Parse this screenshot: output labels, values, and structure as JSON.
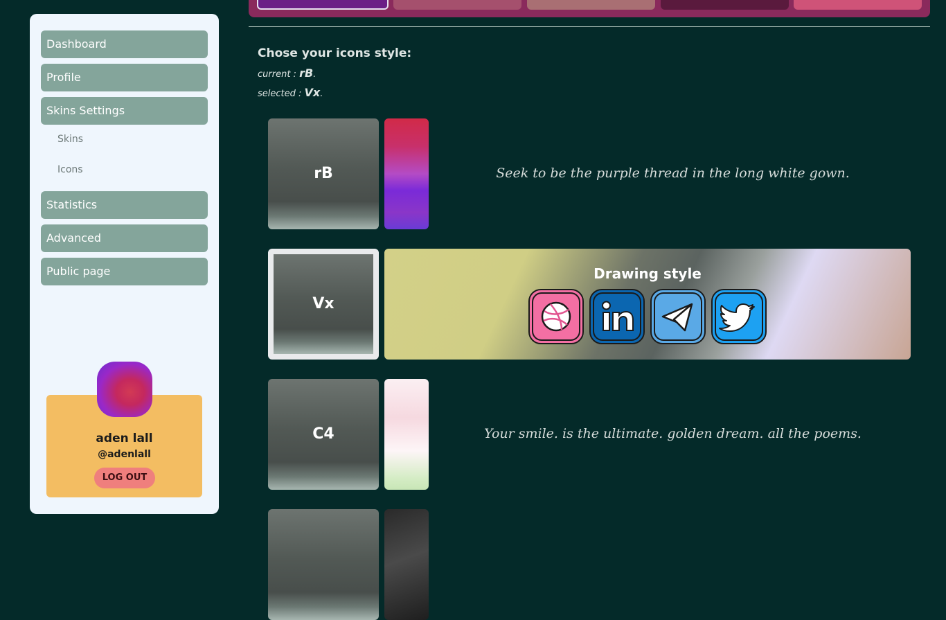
{
  "sidebar": {
    "items": [
      {
        "label": "Dashboard"
      },
      {
        "label": "Profile"
      },
      {
        "label": "Skins Settings"
      },
      {
        "label": "Statistics"
      },
      {
        "label": "Advanced"
      },
      {
        "label": "Public page"
      }
    ],
    "sub_items": [
      {
        "label": "Skins"
      },
      {
        "label": "Icons"
      }
    ],
    "profile": {
      "name": "aden lall",
      "handle": "@adenlall",
      "logout_label": "LOG OUT"
    }
  },
  "top_tabs": [
    {
      "color": "#6b1e86",
      "selected": true
    },
    {
      "color": "#a5506d"
    },
    {
      "color": "#a96f73"
    },
    {
      "color": "#5a1a3d"
    },
    {
      "color": "#cf5378"
    }
  ],
  "icons_section": {
    "heading": "Chose your icons style:",
    "current_prefix": "current : ",
    "current_value": "rB",
    "selected_prefix": "selected : ",
    "selected_value": "Vx",
    "period": "."
  },
  "styles": [
    {
      "code": "rB",
      "quote": "Seek to be the purple thread in the long white gown."
    },
    {
      "code": "Vx",
      "preview_title": "Drawing style"
    },
    {
      "code": "C4",
      "quote": "Your smile. is the ultimate. golden dream. all the poems."
    }
  ],
  "preview_icons": [
    {
      "name": "dribbble-icon",
      "color": "#f36fa3"
    },
    {
      "name": "linkedin-icon",
      "color": "#0b66b0"
    },
    {
      "name": "telegram-icon",
      "color": "#5aa9e6"
    },
    {
      "name": "twitter-icon",
      "color": "#1da1f2"
    }
  ]
}
